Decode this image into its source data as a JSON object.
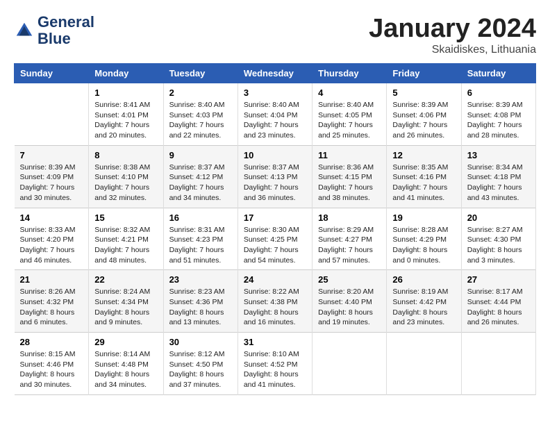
{
  "header": {
    "logo_line1": "General",
    "logo_line2": "Blue",
    "month": "January 2024",
    "location": "Skaidiskes, Lithuania"
  },
  "weekdays": [
    "Sunday",
    "Monday",
    "Tuesday",
    "Wednesday",
    "Thursday",
    "Friday",
    "Saturday"
  ],
  "weeks": [
    [
      {
        "day": "",
        "text": ""
      },
      {
        "day": "1",
        "text": "Sunrise: 8:41 AM\nSunset: 4:01 PM\nDaylight: 7 hours\nand 20 minutes."
      },
      {
        "day": "2",
        "text": "Sunrise: 8:40 AM\nSunset: 4:03 PM\nDaylight: 7 hours\nand 22 minutes."
      },
      {
        "day": "3",
        "text": "Sunrise: 8:40 AM\nSunset: 4:04 PM\nDaylight: 7 hours\nand 23 minutes."
      },
      {
        "day": "4",
        "text": "Sunrise: 8:40 AM\nSunset: 4:05 PM\nDaylight: 7 hours\nand 25 minutes."
      },
      {
        "day": "5",
        "text": "Sunrise: 8:39 AM\nSunset: 4:06 PM\nDaylight: 7 hours\nand 26 minutes."
      },
      {
        "day": "6",
        "text": "Sunrise: 8:39 AM\nSunset: 4:08 PM\nDaylight: 7 hours\nand 28 minutes."
      }
    ],
    [
      {
        "day": "7",
        "text": "Sunrise: 8:39 AM\nSunset: 4:09 PM\nDaylight: 7 hours\nand 30 minutes."
      },
      {
        "day": "8",
        "text": "Sunrise: 8:38 AM\nSunset: 4:10 PM\nDaylight: 7 hours\nand 32 minutes."
      },
      {
        "day": "9",
        "text": "Sunrise: 8:37 AM\nSunset: 4:12 PM\nDaylight: 7 hours\nand 34 minutes."
      },
      {
        "day": "10",
        "text": "Sunrise: 8:37 AM\nSunset: 4:13 PM\nDaylight: 7 hours\nand 36 minutes."
      },
      {
        "day": "11",
        "text": "Sunrise: 8:36 AM\nSunset: 4:15 PM\nDaylight: 7 hours\nand 38 minutes."
      },
      {
        "day": "12",
        "text": "Sunrise: 8:35 AM\nSunset: 4:16 PM\nDaylight: 7 hours\nand 41 minutes."
      },
      {
        "day": "13",
        "text": "Sunrise: 8:34 AM\nSunset: 4:18 PM\nDaylight: 7 hours\nand 43 minutes."
      }
    ],
    [
      {
        "day": "14",
        "text": "Sunrise: 8:33 AM\nSunset: 4:20 PM\nDaylight: 7 hours\nand 46 minutes."
      },
      {
        "day": "15",
        "text": "Sunrise: 8:32 AM\nSunset: 4:21 PM\nDaylight: 7 hours\nand 48 minutes."
      },
      {
        "day": "16",
        "text": "Sunrise: 8:31 AM\nSunset: 4:23 PM\nDaylight: 7 hours\nand 51 minutes."
      },
      {
        "day": "17",
        "text": "Sunrise: 8:30 AM\nSunset: 4:25 PM\nDaylight: 7 hours\nand 54 minutes."
      },
      {
        "day": "18",
        "text": "Sunrise: 8:29 AM\nSunset: 4:27 PM\nDaylight: 7 hours\nand 57 minutes."
      },
      {
        "day": "19",
        "text": "Sunrise: 8:28 AM\nSunset: 4:29 PM\nDaylight: 8 hours\nand 0 minutes."
      },
      {
        "day": "20",
        "text": "Sunrise: 8:27 AM\nSunset: 4:30 PM\nDaylight: 8 hours\nand 3 minutes."
      }
    ],
    [
      {
        "day": "21",
        "text": "Sunrise: 8:26 AM\nSunset: 4:32 PM\nDaylight: 8 hours\nand 6 minutes."
      },
      {
        "day": "22",
        "text": "Sunrise: 8:24 AM\nSunset: 4:34 PM\nDaylight: 8 hours\nand 9 minutes."
      },
      {
        "day": "23",
        "text": "Sunrise: 8:23 AM\nSunset: 4:36 PM\nDaylight: 8 hours\nand 13 minutes."
      },
      {
        "day": "24",
        "text": "Sunrise: 8:22 AM\nSunset: 4:38 PM\nDaylight: 8 hours\nand 16 minutes."
      },
      {
        "day": "25",
        "text": "Sunrise: 8:20 AM\nSunset: 4:40 PM\nDaylight: 8 hours\nand 19 minutes."
      },
      {
        "day": "26",
        "text": "Sunrise: 8:19 AM\nSunset: 4:42 PM\nDaylight: 8 hours\nand 23 minutes."
      },
      {
        "day": "27",
        "text": "Sunrise: 8:17 AM\nSunset: 4:44 PM\nDaylight: 8 hours\nand 26 minutes."
      }
    ],
    [
      {
        "day": "28",
        "text": "Sunrise: 8:15 AM\nSunset: 4:46 PM\nDaylight: 8 hours\nand 30 minutes."
      },
      {
        "day": "29",
        "text": "Sunrise: 8:14 AM\nSunset: 4:48 PM\nDaylight: 8 hours\nand 34 minutes."
      },
      {
        "day": "30",
        "text": "Sunrise: 8:12 AM\nSunset: 4:50 PM\nDaylight: 8 hours\nand 37 minutes."
      },
      {
        "day": "31",
        "text": "Sunrise: 8:10 AM\nSunset: 4:52 PM\nDaylight: 8 hours\nand 41 minutes."
      },
      {
        "day": "",
        "text": ""
      },
      {
        "day": "",
        "text": ""
      },
      {
        "day": "",
        "text": ""
      }
    ]
  ]
}
